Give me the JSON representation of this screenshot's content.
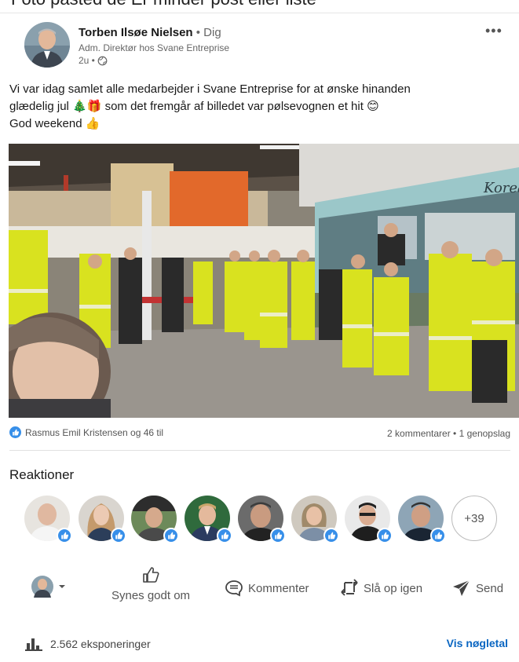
{
  "top_strip": {
    "text": "Foto pasted de Er minder post eller liste"
  },
  "post": {
    "author": {
      "name": "Torben Ilsøe Nielsen",
      "degree": "• Dig",
      "headline": "Adm. Direktør hos Svane Entreprise",
      "time": "2u •"
    },
    "text_lines": [
      "Vi var idag samlet alle medarbejder i Svane Entreprise for at ønske hinanden",
      "glædelig jul 🎄🎁 som det fremgår af billedet var pølsevognen et hit 😊",
      "God weekend 👍"
    ],
    "photo_sign": "Korea"
  },
  "social": {
    "likes_text": "Rasmus Emil Kristensen og 46 til",
    "comments_text": "2 kommentarer • 1 genopslag"
  },
  "reactions": {
    "title": "Reaktioner",
    "more_count": "+39"
  },
  "actions": {
    "like": "Synes godt om",
    "comment": "Kommenter",
    "repost": "Slå op igen",
    "send": "Send"
  },
  "footer": {
    "impressions": "2.562 eksponeringer",
    "analytics_link": "Vis nøgletal"
  },
  "colors": {
    "accent_blue": "#0a66c2",
    "reaction_blue": "#378fe9",
    "safety_yellow": "#d9e21f"
  }
}
